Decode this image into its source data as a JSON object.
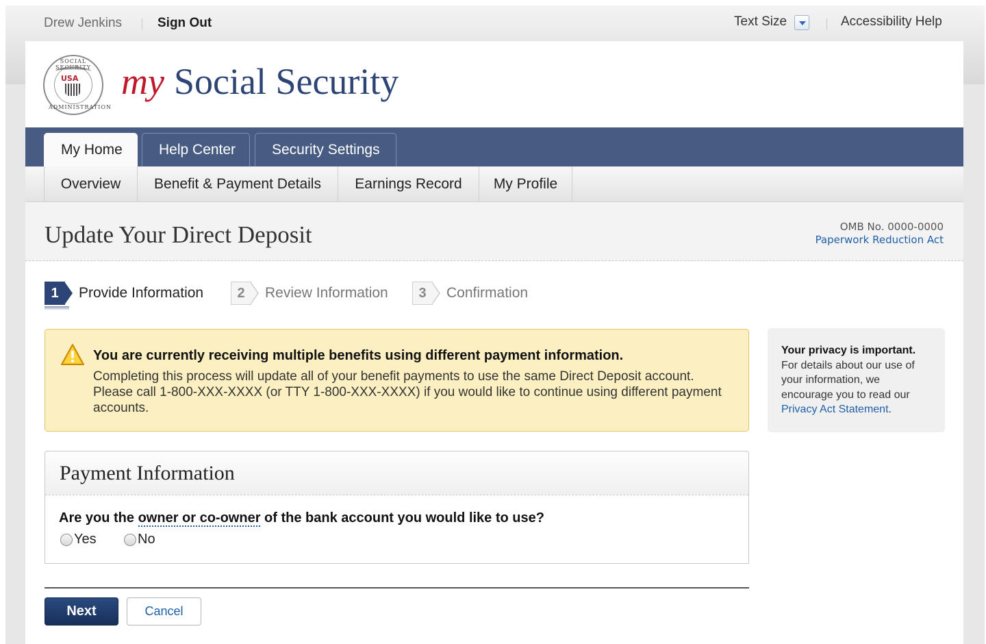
{
  "utility": {
    "user_name": "Drew Jenkins",
    "sign_out": "Sign Out",
    "text_size": "Text Size",
    "accessibility_help": "Accessibility Help"
  },
  "header": {
    "brand_my": "my",
    "brand_name": "Social Security",
    "seal_top": "SOCIAL SECURITY",
    "seal_bottom": "ADMINISTRATION",
    "seal_center": "USA"
  },
  "primary_tabs": [
    {
      "label": "My Home",
      "active": true
    },
    {
      "label": "Help Center",
      "active": false
    },
    {
      "label": "Security Settings",
      "active": false
    }
  ],
  "secondary_tabs": [
    {
      "label": "Overview"
    },
    {
      "label": "Benefit & Payment Details"
    },
    {
      "label": "Earnings Record"
    },
    {
      "label": "My Profile"
    }
  ],
  "page": {
    "title": "Update Your Direct Deposit",
    "omb": "OMB No. 0000-0000",
    "paperwork_link": "Paperwork Reduction Act"
  },
  "steps": [
    {
      "number": "1",
      "label": "Provide Information",
      "active": true
    },
    {
      "number": "2",
      "label": "Review Information",
      "active": false
    },
    {
      "number": "3",
      "label": "Confirmation",
      "active": false
    }
  ],
  "alert": {
    "icon": "warning-icon",
    "title": "You are currently receiving multiple benefits using different payment information.",
    "body": "Completing this process will update all of your benefit payments to use the same Direct Deposit account. Please call 1-800-XXX-XXXX (or TTY 1-800-XXX-XXXX) if you would like to continue using different payment accounts."
  },
  "privacy": {
    "title": "Your privacy is important.",
    "body": "For details about our use of your information, we encourage you to read our",
    "link": "Privacy Act Statement",
    "end": "."
  },
  "payment": {
    "title": "Payment Information",
    "question_before": "Are you the ",
    "question_term": "owner or co-owner",
    "question_after": " of the bank account you would like to use?",
    "options": [
      {
        "label": "Yes",
        "selected": false
      },
      {
        "label": "No",
        "selected": false
      }
    ]
  },
  "actions": {
    "next": "Next",
    "cancel": "Cancel"
  },
  "colors": {
    "nav_blue": "#485b82",
    "brand_navy": "#2d4576",
    "brand_red": "#c0172b",
    "link_blue": "#1f5fa8",
    "alert_bg": "#fcf0c2"
  }
}
